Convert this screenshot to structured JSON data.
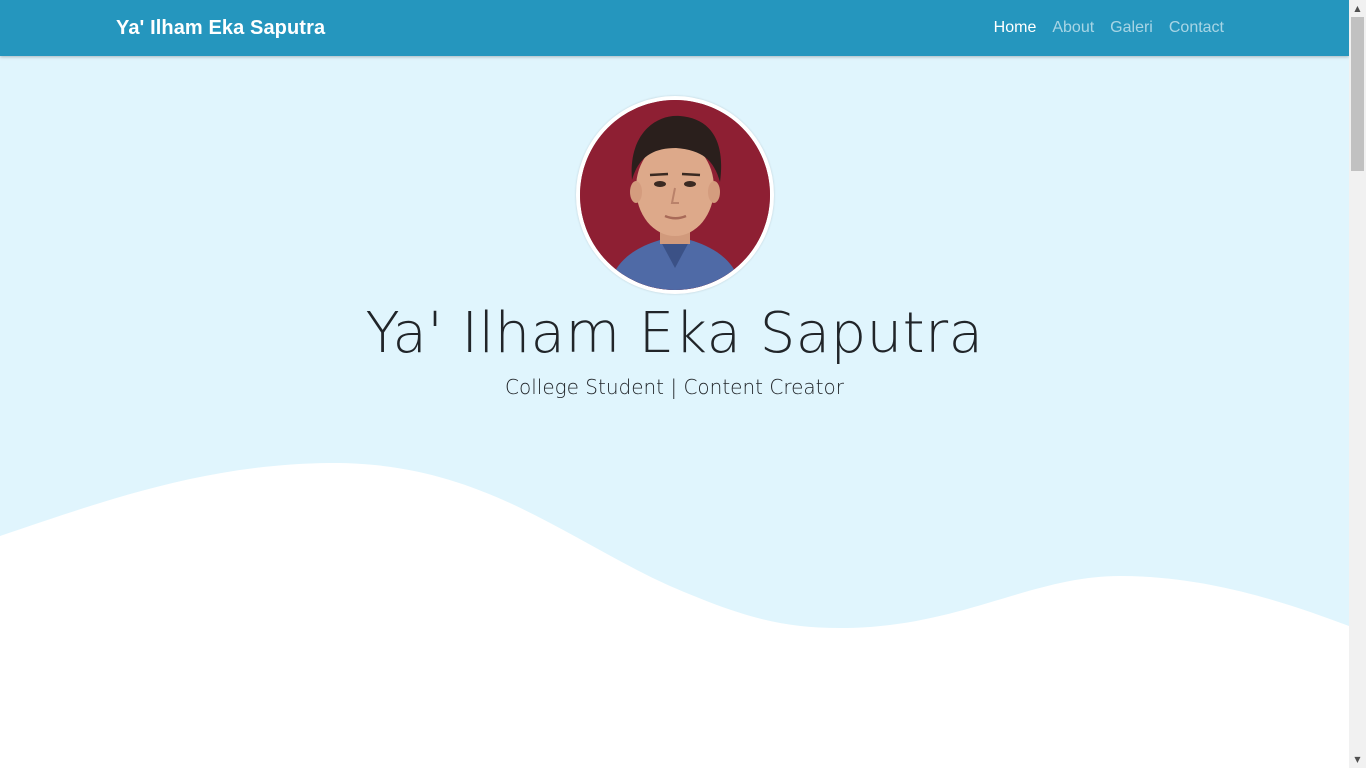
{
  "navbar": {
    "brand": "Ya' Ilham Eka Saputra",
    "links": [
      {
        "label": "Home",
        "active": true
      },
      {
        "label": "About",
        "active": false
      },
      {
        "label": "Galeri",
        "active": false
      },
      {
        "label": "Contact",
        "active": false
      }
    ]
  },
  "hero": {
    "name": "Ya' Ilham Eka Saputra",
    "subtitle": "College Student | Content Creator"
  },
  "colors": {
    "navbar_bg": "#2596be",
    "hero_bg": "#e0f5fd",
    "wave": "#ffffff",
    "avatar_bg": "#8e1f33"
  },
  "icons": {
    "scroll_up": "triangle-up-icon",
    "scroll_down": "triangle-down-icon"
  }
}
